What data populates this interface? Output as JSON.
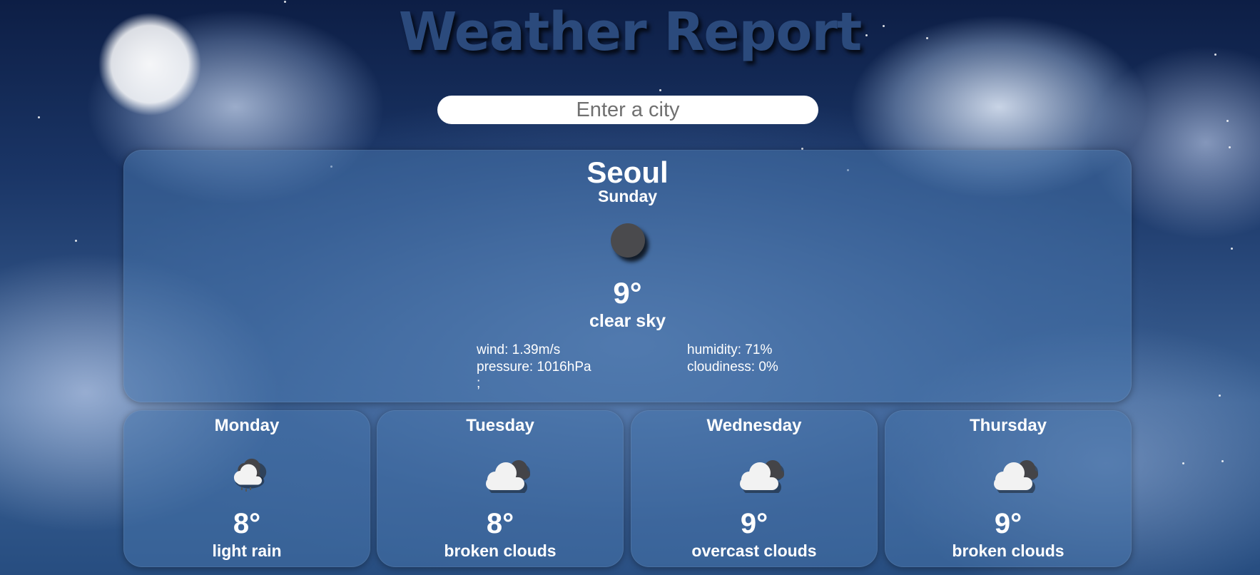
{
  "header": {
    "title": "Weather Report"
  },
  "search": {
    "placeholder": "Enter a city"
  },
  "current": {
    "city": "Seoul",
    "day": "Sunday",
    "icon": "moon-icon",
    "temperature": "9°",
    "description": "clear sky",
    "wind": "wind: 1.39m/s",
    "pressure": "pressure: 1016hPa",
    "humidity": "humidity: 71%",
    "cloudiness": "cloudiness: 0%",
    "stray": ";"
  },
  "forecast": [
    {
      "day": "Monday",
      "icon": "cloud-rain-icon",
      "temperature": "8°",
      "description": "light rain"
    },
    {
      "day": "Tuesday",
      "icon": "broken-clouds-icon",
      "temperature": "8°",
      "description": "broken clouds"
    },
    {
      "day": "Wednesday",
      "icon": "overcast-clouds-icon",
      "temperature": "9°",
      "description": "overcast clouds"
    },
    {
      "day": "Thursday",
      "icon": "broken-clouds-icon",
      "temperature": "9°",
      "description": "broken clouds"
    }
  ],
  "colors": {
    "title": "#2b4a7c",
    "card": "#4673aa",
    "moon": "#4a4a4d",
    "cloud_front": "#f2f2f2",
    "cloud_back": "#444448"
  }
}
